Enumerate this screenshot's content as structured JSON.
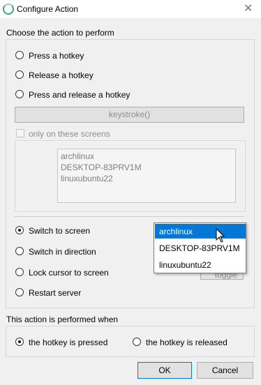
{
  "window": {
    "title": "Configure Action",
    "close_glyph": "✕"
  },
  "action_group": {
    "label": "Choose the action to perform",
    "radios": [
      {
        "label": "Press a hotkey",
        "checked": false
      },
      {
        "label": "Release a hotkey",
        "checked": false
      },
      {
        "label": "Press and release a hotkey",
        "checked": false
      }
    ],
    "keystroke_button": "keystroke()",
    "screens_checkbox": {
      "label": "only on these screens",
      "checked": false
    },
    "screens_list": [
      "archlinux",
      "DESKTOP-83PRV1M",
      "linuxubuntu22"
    ],
    "switch_radios": [
      {
        "label": "Switch to screen",
        "checked": true
      },
      {
        "label": "Switch in direction",
        "checked": false
      },
      {
        "label": "Lock cursor to screen",
        "checked": false
      },
      {
        "label": "Restart server",
        "checked": false
      }
    ],
    "screen_dropdown": {
      "options": [
        "archlinux",
        "DESKTOP-83PRV1M",
        "linuxubuntu22"
      ],
      "highlighted": "archlinux"
    },
    "lock_mode_partial": "toggle"
  },
  "trigger_group": {
    "label": "This action is performed when",
    "radios": [
      {
        "label": "the hotkey is pressed",
        "checked": true
      },
      {
        "label": "the hotkey is released",
        "checked": false
      }
    ]
  },
  "buttons": {
    "ok": "OK",
    "cancel": "Cancel"
  },
  "colors": {
    "accent": "#0078d7",
    "window_bg": "#f0f0f0",
    "app_icon": "#3aa77b"
  },
  "icons": {
    "app": "synergy-ring-icon",
    "cursor": "mouse-pointer-icon"
  }
}
